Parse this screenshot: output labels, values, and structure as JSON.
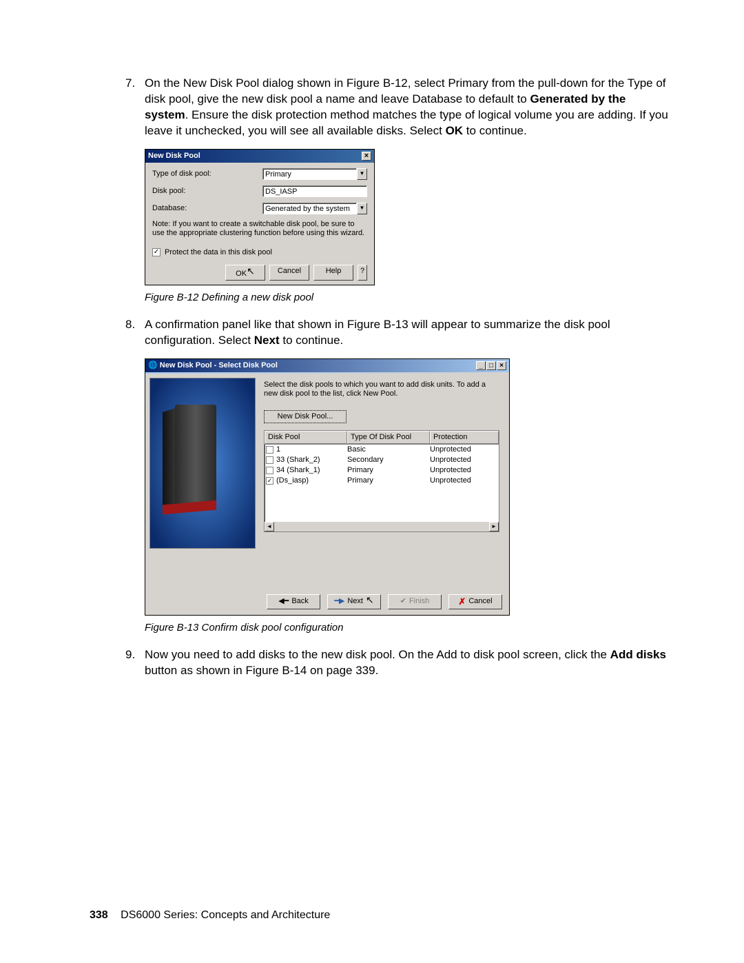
{
  "step7": {
    "num": "7.",
    "text_before": "On the New Disk Pool dialog shown in Figure B-12, select Primary from the pull-down for the Type of disk pool, give the new disk pool a name and leave Database to default to ",
    "bold1": "Generated by the system",
    "text_mid": ". Ensure the disk protection method matches the type of logical volume you are adding. If you leave it unchecked, you will see all available disks. Select ",
    "bold2": "OK",
    "text_after": " to continue."
  },
  "dialog1": {
    "title": "New Disk Pool",
    "labels": {
      "type": "Type of disk pool:",
      "pool": "Disk pool:",
      "db": "Database:"
    },
    "values": {
      "type": "Primary",
      "pool": "DS_IASP",
      "db": "Generated by the system"
    },
    "note": "Note:  If you want to create a switchable disk pool, be sure to use the appropriate clustering function before using this wizard.",
    "protect": "Protect the data in this disk pool",
    "buttons": {
      "ok": "OK",
      "cancel": "Cancel",
      "help": "Help",
      "q": "?"
    }
  },
  "caption1": "Figure B-12   Defining a new disk pool",
  "step8": {
    "num": "8.",
    "text_before": "A confirmation panel like that shown in Figure B-13 will appear to summarize the disk pool configuration. Select ",
    "bold1": "Next",
    "text_after": " to continue."
  },
  "dialog2": {
    "title": "New Disk Pool - Select Disk Pool",
    "instr": "Select the disk pools to which you want to add disk units.  To add a new disk pool to the list, click New Pool.",
    "newpool": "New Disk Pool...",
    "headers": {
      "c1": "Disk Pool",
      "c2": "Type Of Disk Pool",
      "c3": "Protection"
    },
    "rows": [
      {
        "checked": false,
        "c1": "1",
        "c2": "Basic",
        "c3": "Unprotected"
      },
      {
        "checked": false,
        "c1": "33 (Shark_2)",
        "c2": "Secondary",
        "c3": "Unprotected"
      },
      {
        "checked": false,
        "c1": "34 (Shark_1)",
        "c2": "Primary",
        "c3": "Unprotected"
      },
      {
        "checked": true,
        "c1": "     (Ds_iasp)",
        "c2": "Primary",
        "c3": "Unprotected"
      }
    ],
    "buttons": {
      "back": "Back",
      "next": "Next",
      "finish": "Finish",
      "cancel": "Cancel"
    }
  },
  "caption2": "Figure B-13   Confirm disk pool configuration",
  "step9": {
    "num": "9.",
    "text_before": "Now you need to add disks to the new disk pool. On the Add to disk pool screen, click the ",
    "bold1": "Add disks",
    "text_after": " button as shown in Figure B-14 on page 339."
  },
  "footer": {
    "page": "338",
    "title": "DS6000 Series: Concepts and Architecture"
  }
}
